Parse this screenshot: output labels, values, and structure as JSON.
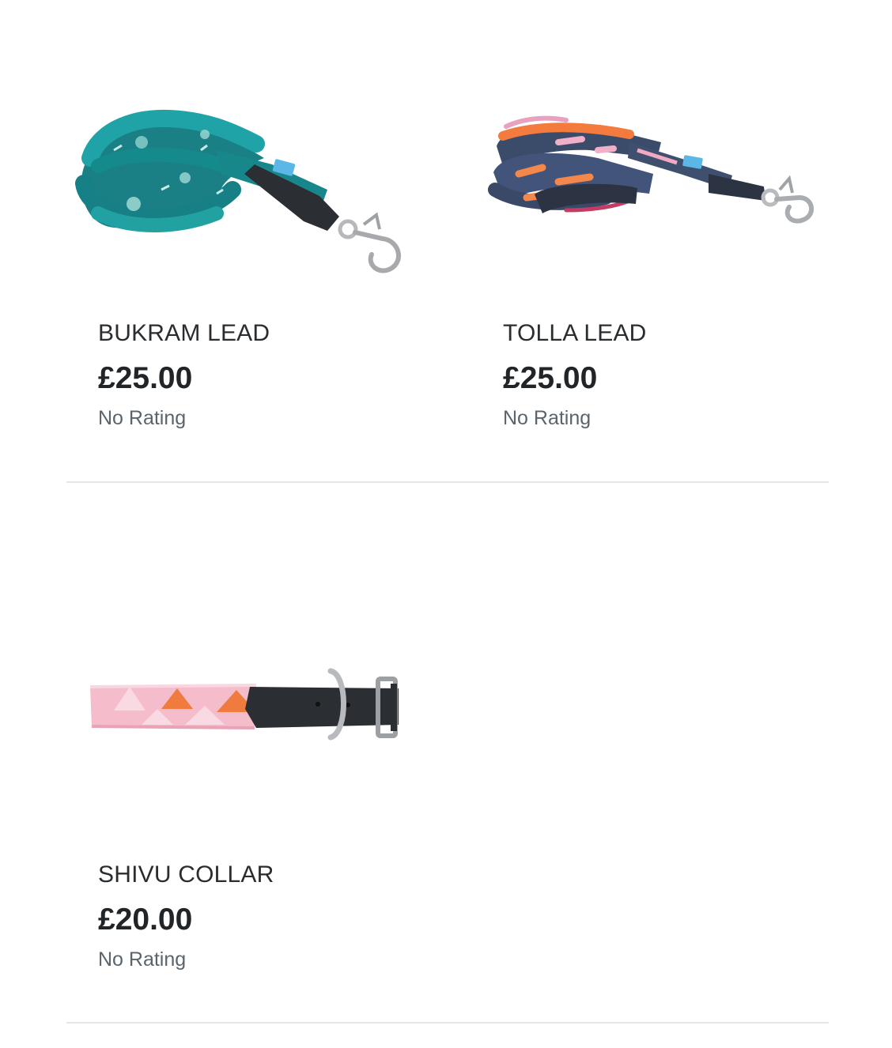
{
  "products": [
    {
      "name": "BUKRAM LEAD",
      "price": "£25.00",
      "rating": "No Rating",
      "image": "teal-patterned-dog-lead"
    },
    {
      "name": "TOLLA LEAD",
      "price": "£25.00",
      "rating": "No Rating",
      "image": "pink-orange-ikat-dog-lead"
    },
    {
      "name": "SHIVU COLLAR",
      "price": "£20.00",
      "rating": "No Rating",
      "image": "pink-orange-triangle-dog-collar"
    }
  ],
  "colors": {
    "divider": "#e3e5e7",
    "name_text": "#2a2d30",
    "price_text": "#222528",
    "rating_text": "#5c646b",
    "teal": "#1d8f96",
    "pink": "#f3b9c6",
    "orange": "#ef7d3c",
    "leather": "#2b2e33"
  }
}
